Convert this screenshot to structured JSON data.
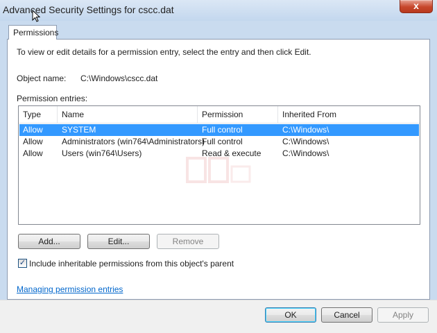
{
  "window": {
    "title": "Advanced Security Settings for cscc.dat",
    "close_label": "x"
  },
  "tabs": [
    {
      "label": "Permissions"
    }
  ],
  "permissions": {
    "info": "To view or edit details for a permission entry, select the entry and then click Edit.",
    "object_name_label": "Object name:",
    "object_name_value": "C:\\Windows\\cscc.dat",
    "entries_label": "Permission entries:",
    "columns": [
      "Type",
      "Name",
      "Permission",
      "Inherited From"
    ],
    "rows": [
      {
        "type": "Allow",
        "name": "SYSTEM",
        "permission": "Full control",
        "inherited_from": "C:\\Windows\\",
        "selected": true
      },
      {
        "type": "Allow",
        "name": "Administrators (win764\\Administrators)",
        "permission": "Full control",
        "inherited_from": "C:\\Windows\\",
        "selected": false
      },
      {
        "type": "Allow",
        "name": "Users (win764\\Users)",
        "permission": "Read & execute",
        "inherited_from": "C:\\Windows\\",
        "selected": false
      }
    ],
    "buttons": {
      "add": "Add...",
      "edit": "Edit...",
      "remove": "Remove"
    },
    "inherit_checkbox": {
      "label": "Include inheritable permissions from this object's parent",
      "checked": true
    },
    "link": "Managing permission entries"
  },
  "footer": {
    "ok": "OK",
    "cancel": "Cancel",
    "apply": "Apply"
  },
  "colors": {
    "selection": "#3399ff",
    "link": "#0066cc"
  }
}
